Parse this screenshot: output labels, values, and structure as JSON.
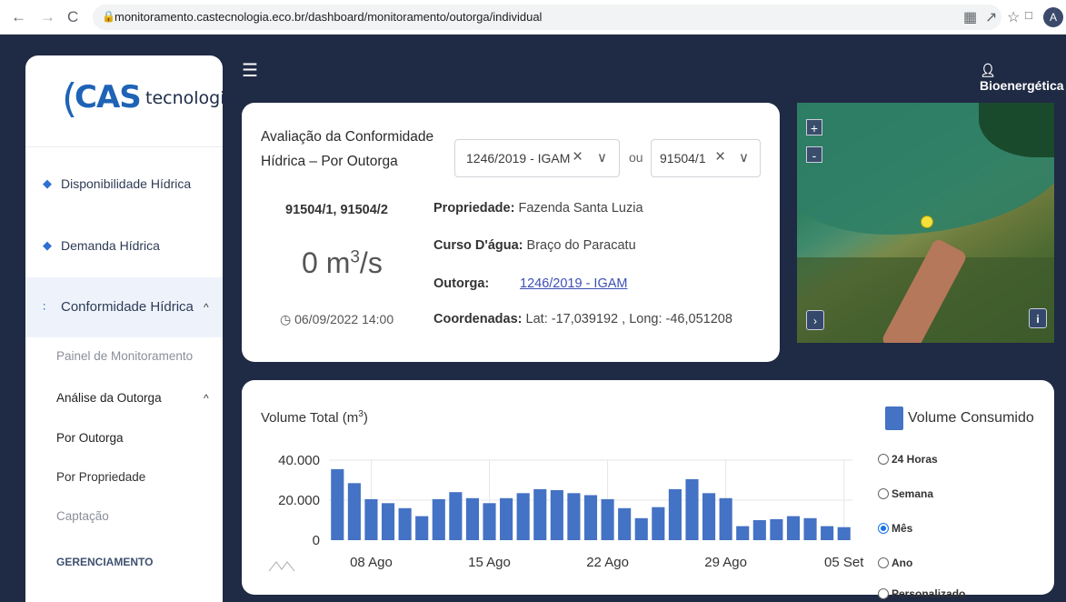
{
  "browser": {
    "url": "monitoramento.castecnologia.eco.br/dashboard/monitoramento/outorga/individual",
    "back_icon": "←",
    "forward_icon": "→",
    "reload_icon": "C",
    "profile_initial": "A"
  },
  "header": {
    "user_name": "Bioenergética"
  },
  "sidebar": {
    "logo_cas": "CAS",
    "logo_tecnologia": "tecnologia",
    "items": [
      {
        "label": "Disponibilidade Hídrica"
      },
      {
        "label": "Demanda Hídrica"
      },
      {
        "label": "Conformidade Hídrica"
      }
    ],
    "sub_items": [
      {
        "label": "Painel de Monitoramento"
      },
      {
        "label": "Análise da Outorga"
      },
      {
        "label": "Por Outorga"
      },
      {
        "label": "Por Propriedade"
      },
      {
        "label": "Captação"
      }
    ],
    "section_label": "GERENCIAMENTO"
  },
  "info_card": {
    "title": "Avaliação da Conformidade Hídrica – Por Outorga",
    "select1_value": "1246/2019 - IGAM",
    "separator": "ou",
    "select2_value": "91504/1",
    "ids": "91504/1, 91504/2",
    "flow_value": "0 m",
    "flow_exp": "3",
    "flow_unit": "/s",
    "datetime": "06/09/2022 14:00",
    "propriedade_label": "Propriedade:",
    "propriedade_value": "Fazenda Santa Luzia",
    "curso_label": "Curso D'água:",
    "curso_value": "Braço do Paracatu",
    "outorga_label": "Outorga:",
    "outorga_value": "1246/2019 - IGAM",
    "coord_label": "Coordenadas:",
    "coord_value": "Lat: -17,039192 , Long: -46,051208"
  },
  "map": {
    "zoom_in": "+",
    "zoom_out": "-",
    "expand": "›",
    "info": "i"
  },
  "chart_card": {
    "legend_label": "Volume Consumido",
    "period_options": [
      "24 Horas",
      "Semana",
      "Mês",
      "Ano",
      "Personalizado"
    ],
    "selected_period": "Mês"
  },
  "chart_data": {
    "type": "bar",
    "title": "Volume Total (m³)",
    "title_main": "Volume Total (m",
    "title_exp": "3",
    "title_close": ")",
    "series": [
      {
        "name": "Volume Consumido",
        "color": "#4472c4",
        "values": [
          35500,
          28500,
          20500,
          18500,
          16000,
          12000,
          20500,
          24000,
          21000,
          18500,
          21000,
          23500,
          25500,
          25000,
          23500,
          22500,
          20500,
          16000,
          11000,
          16500,
          25500,
          30500,
          23500,
          21000,
          7000,
          10000,
          10500,
          12000,
          11000,
          7000,
          6500
        ]
      }
    ],
    "x_tick_labels": [
      "08 Ago",
      "15 Ago",
      "22 Ago",
      "29 Ago",
      "05 Set"
    ],
    "x_tick_index": [
      2,
      9,
      16,
      23,
      30
    ],
    "y_ticks": [
      0,
      20000,
      40000
    ],
    "y_tick_labels": [
      "0",
      "20.000",
      "40.000"
    ],
    "ylim": [
      0,
      40000
    ],
    "grid": true
  }
}
